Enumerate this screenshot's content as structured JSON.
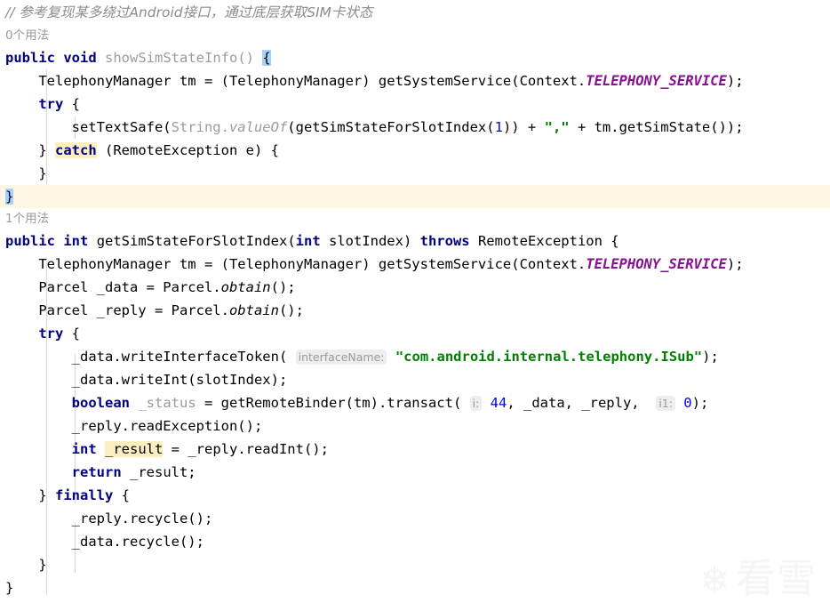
{
  "editor": {
    "language": "java",
    "colors": {
      "background": "#ffffff",
      "keyword": "#000080",
      "string": "#008000",
      "number": "#0000ff",
      "static_field": "#871094",
      "comment": "#8c8c8c",
      "unused_gray": "#9b9b9b",
      "current_line": "#fdf6e3",
      "identifier_highlight": "#fbeec0",
      "bracket_match": "#a6d2ff",
      "indent_guide": "#d8d8d8",
      "hint_background": "#eeeeee"
    },
    "comment": "// 参考复现某多绕过Android接口，通过底层获取SIM卡状态",
    "usages": {
      "method_one": "0个用法",
      "method_two": "1个用法"
    },
    "hints": {
      "interface_name": "interfaceName:",
      "i": "i:",
      "i1": "i1:"
    },
    "tokens": {
      "public": "public",
      "void": "void",
      "int": "int",
      "boolean": "boolean",
      "try": "try",
      "catch": "catch",
      "finally": "finally",
      "throws": "throws",
      "return": "return"
    },
    "code": {
      "m1_signature_name": "showSimStateInfo()",
      "m1_line_tm": "TelephonyManager tm = (TelephonyManager) getSystemService(Context.",
      "telephony_service": "TELEPHONY_SERVICE",
      "m1_settextsafe_a": "setTextSafe(",
      "m1_string": "String.",
      "m1_valueof": "valueOf",
      "m1_call": "(getSimStateForSlotIndex(",
      "m1_arg": "1",
      "m1_tail": ")) + ",
      "m1_comma_str": "\",\"",
      "m1_tail2": " + tm.getSimState());",
      "m1_catch_sig": "(RemoteException e) {",
      "m2_name": "getSimStateForSlotIndex(",
      "m2_param_type": "int",
      "m2_param_name": " slotIndex) ",
      "m2_throws_type": " RemoteException {",
      "parcel_data": "Parcel _data = Parcel.",
      "parcel_reply": "Parcel _reply = Parcel.",
      "obtain": "obtain",
      "obtain_tail": "();",
      "write_token": "_data.writeInterfaceToken(",
      "isub_string": "\"com.android.internal.telephony.ISub\"",
      "write_token_tail": ");",
      "write_int": "_data.writeInt(slotIndex);",
      "status_var": "_status",
      "transact_head": " = getRemoteBinder(tm).transact(",
      "transact_code": "44",
      "transact_mid": ", _data, _reply, ",
      "transact_flag": "0",
      "transact_tail": ");",
      "read_exception": "_reply.readException();",
      "result_var": "_result",
      "result_tail": " = _reply.readInt();",
      "return_result": " _result;",
      "reply_recycle": "_reply.recycle();",
      "data_recycle": "_data.recycle();",
      "brace_close": "}",
      "brace_close_indent": "    }",
      "catch_prefix": "    } ",
      "finally_prefix": "    } "
    }
  },
  "watermark": {
    "icon": "snowflake-icon",
    "glyph": "❄",
    "text": "看雪"
  }
}
